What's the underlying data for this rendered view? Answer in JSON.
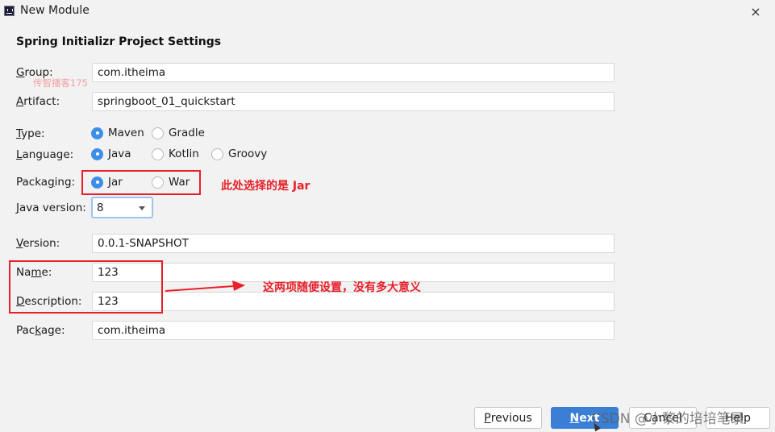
{
  "window": {
    "title": "New Module",
    "icon": "intellij-icon",
    "close_glyph": "×"
  },
  "section_title": "Spring Initializr Project Settings",
  "watermark": "传智播客175",
  "form": {
    "group": {
      "label_u": "G",
      "label_rest": "roup:",
      "value": "com.itheima"
    },
    "artifact": {
      "label_u": "A",
      "label_rest": "rtifact:",
      "value": "springboot_01_quickstart"
    },
    "type": {
      "label_u": "T",
      "label_rest": "ype:",
      "options": [
        {
          "label": "Maven",
          "selected": true
        },
        {
          "label": "Gradle",
          "selected": false
        }
      ]
    },
    "language": {
      "label_u": "L",
      "label_rest": "anguage:",
      "options": [
        {
          "label": "Java",
          "selected": true
        },
        {
          "label": "Kotlin",
          "selected": false
        },
        {
          "label": "Groovy",
          "selected": false
        }
      ]
    },
    "packaging": {
      "label_pre": "Packa",
      "label_u": "g",
      "label_rest": "ing:",
      "options": [
        {
          "label": "Jar",
          "selected": true
        },
        {
          "label": "War",
          "selected": false
        }
      ]
    },
    "java_version": {
      "label_u": "J",
      "label_rest": "ava version:",
      "value": "8"
    },
    "version": {
      "label_u": "V",
      "label_rest": "ersion:",
      "value": "0.0.1-SNAPSHOT"
    },
    "name": {
      "label_pre": "Na",
      "label_u": "m",
      "label_rest": "e:",
      "value": "123"
    },
    "description": {
      "label_u": "D",
      "label_rest": "escription:",
      "value": "123"
    },
    "package": {
      "label_pre": "Pac",
      "label_u": "k",
      "label_rest": "age:",
      "value": "com.itheima"
    }
  },
  "annotations": {
    "packaging_note": "此处选择的是 Jar",
    "name_desc_note": "这两项随便设置，没有多大意义",
    "color": "#e8202a"
  },
  "buttons": {
    "previous": {
      "u": "P",
      "rest": "revious"
    },
    "next": {
      "u": "N",
      "rest": "ext"
    },
    "cancel": "Cancel",
    "help": "Help"
  },
  "overlay_watermark": "CSDN @小黎的培培笔录",
  "accent_color": "#3d8ee8"
}
